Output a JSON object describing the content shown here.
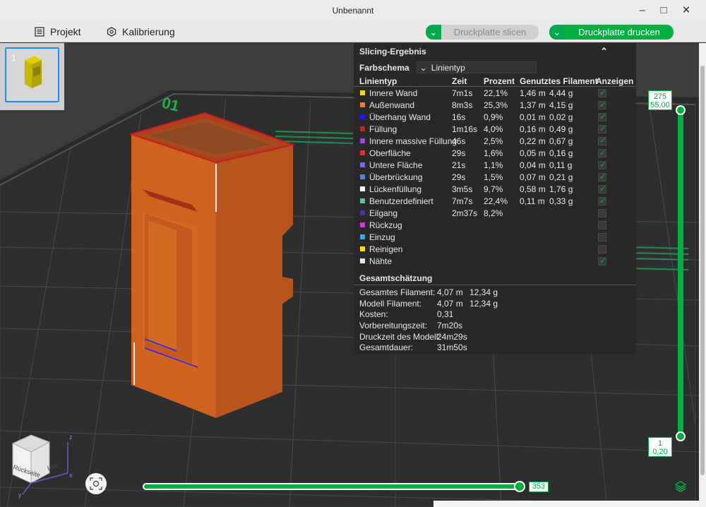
{
  "window": {
    "title": "Unbenannt"
  },
  "toolbar": {
    "project_label": "Projekt",
    "calibration_label": "Kalibrierung",
    "slice_label": "Druckplatte slicen",
    "print_label": "Druckplatte drucken"
  },
  "plate": {
    "index": "1"
  },
  "results": {
    "title": "Slicing-Ergebnis",
    "color_scheme_label": "Farbschema",
    "color_scheme_value": "Linientyp",
    "columns": {
      "type": "Linientyp",
      "time": "Zeit",
      "percent": "Prozent",
      "filament": "Genutztes Filament",
      "show": "Anzeigen"
    },
    "rows": [
      {
        "name": "Innere Wand",
        "color": "#f6d32d",
        "time": "7m1s",
        "percent": "22,1%",
        "len": "1,46 m",
        "weight": "4,44 g",
        "visible": true
      },
      {
        "name": "Außenwand",
        "color": "#f07a3c",
        "time": "8m3s",
        "percent": "25,3%",
        "len": "1,37 m",
        "weight": "4,15 g",
        "visible": true
      },
      {
        "name": "Überhang Wand",
        "color": "#1a1aff",
        "time": "16s",
        "percent": "0,9%",
        "len": "0,01 m",
        "weight": "0,02 g",
        "visible": true
      },
      {
        "name": "Füllung",
        "color": "#b0302e",
        "time": "1m16s",
        "percent": "4,0%",
        "len": "0,16 m",
        "weight": "0,49 g",
        "visible": true
      },
      {
        "name": "Innere massive Füllung",
        "color": "#9a4bd6",
        "time": "46s",
        "percent": "2,5%",
        "len": "0,22 m",
        "weight": "0,67 g",
        "visible": true
      },
      {
        "name": "Oberfläche",
        "color": "#e0303a",
        "time": "29s",
        "percent": "1,6%",
        "len": "0,05 m",
        "weight": "0,16 g",
        "visible": true
      },
      {
        "name": "Untere Fläche",
        "color": "#6d6dde",
        "time": "21s",
        "percent": "1,1%",
        "len": "0,04 m",
        "weight": "0,11 g",
        "visible": true
      },
      {
        "name": "Überbrückung",
        "color": "#5b86c4",
        "time": "29s",
        "percent": "1,5%",
        "len": "0,07 m",
        "weight": "0,21 g",
        "visible": true
      },
      {
        "name": "Lückenfüllung",
        "color": "#ffffff",
        "time": "3m5s",
        "percent": "9,7%",
        "len": "0,58 m",
        "weight": "1,76 g",
        "visible": true
      },
      {
        "name": "Benutzerdefiniert",
        "color": "#58c49b",
        "time": "7m7s",
        "percent": "22,4%",
        "len": "0,11 m",
        "weight": "0,33 g",
        "visible": true
      },
      {
        "name": "Eilgang",
        "color": "#3a3f9e",
        "time": "2m37s",
        "percent": "8,2%",
        "len": "",
        "weight": "",
        "visible": false
      },
      {
        "name": "Rückzug",
        "color": "#d23bd2",
        "time": "",
        "percent": "",
        "len": "",
        "weight": "",
        "visible": false
      },
      {
        "name": "Einzug",
        "color": "#3aa9de",
        "time": "",
        "percent": "",
        "len": "",
        "weight": "",
        "visible": false
      },
      {
        "name": "Reinigen",
        "color": "#f6e000",
        "time": "",
        "percent": "",
        "len": "",
        "weight": "",
        "visible": false
      },
      {
        "name": "Nähte",
        "color": "#e6e6e6",
        "time": "",
        "percent": "",
        "len": "",
        "weight": "",
        "visible": true
      }
    ],
    "summary_title": "Gesamtschätzung",
    "summary": [
      {
        "label": "Gesamtes Filament:",
        "v1": "4,07 m",
        "v2": "12,34 g"
      },
      {
        "label": "Modell Filament:",
        "v1": "4,07 m",
        "v2": "12,34 g"
      },
      {
        "label": "Kosten:",
        "v1": "0,31",
        "v2": ""
      },
      {
        "label": "Vorbereitungszeit:",
        "v1": "7m20s",
        "v2": ""
      },
      {
        "label": "Druckzeit des Modell:",
        "v1": "24m29s",
        "v2": ""
      },
      {
        "label": "Gesamtdauer:",
        "v1": "31m50s",
        "v2": ""
      }
    ]
  },
  "layer_slider": {
    "top_layer": "275",
    "top_height": "55,00",
    "bottom_layer": "1",
    "bottom_height": "0,20"
  },
  "move_slider": {
    "value": "353"
  },
  "view_cube": {
    "back_label": "Rückseite",
    "left_label": "Left",
    "axis_x": "x",
    "axis_y": "y",
    "axis_z": "z"
  },
  "colors": {
    "accent": "#00ae42",
    "model": "#d2691e"
  }
}
